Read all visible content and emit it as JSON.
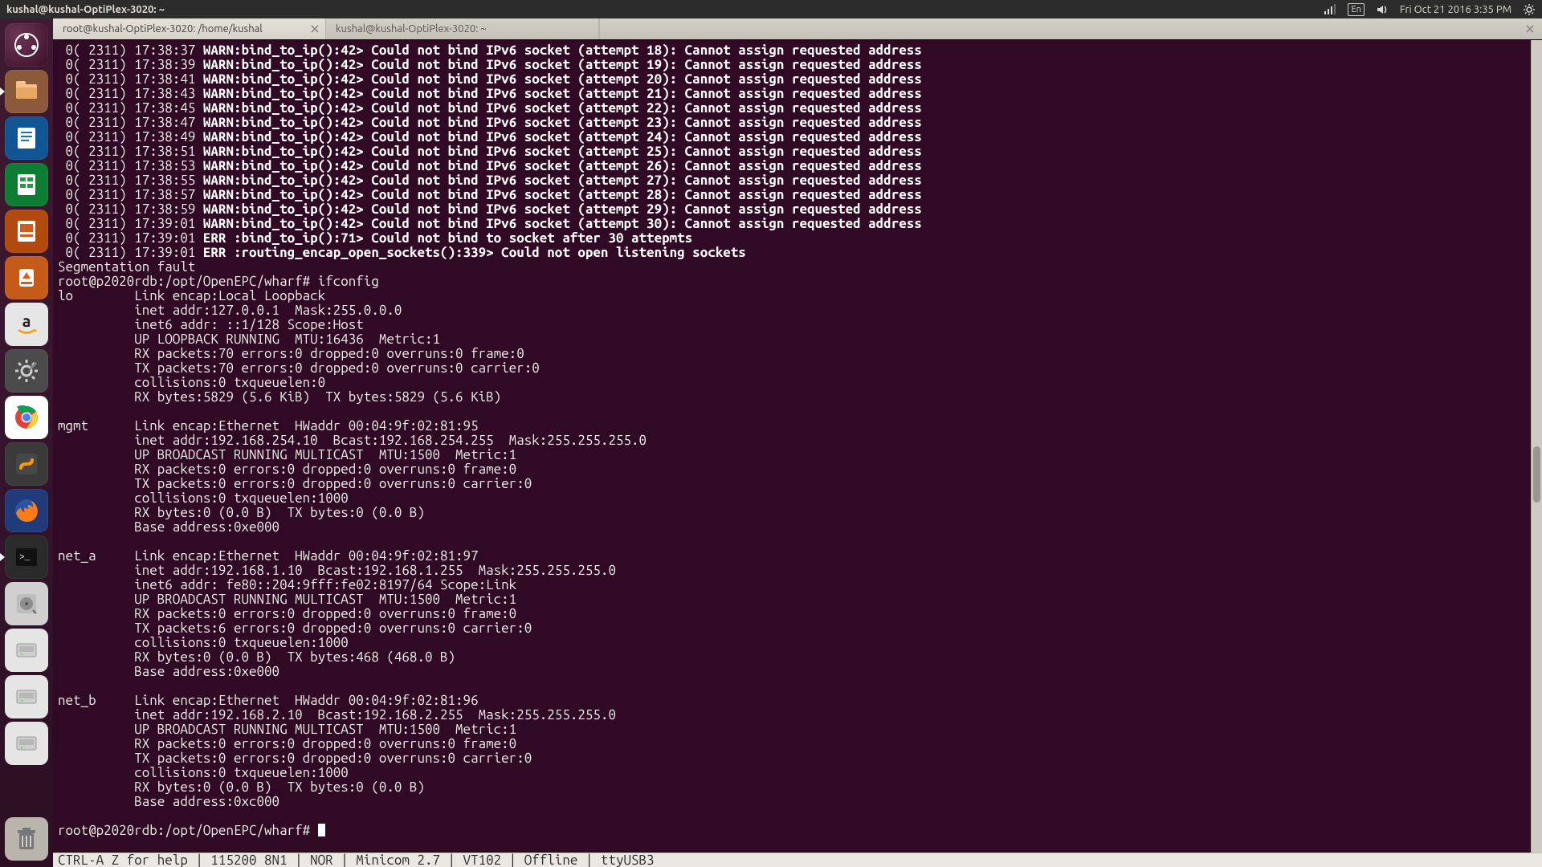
{
  "panel": {
    "window_title": "kushal@kushal-OptiPlex-3020: ~",
    "lang": "En",
    "clock": "Fri Oct 21 2016  3:35 PM"
  },
  "tabs": [
    {
      "title": "root@kushal-OptiPlex-3020: /home/kushal",
      "active": true
    },
    {
      "title": "kushal@kushal-OptiPlex-3020: ~",
      "active": false
    }
  ],
  "launcher": [
    {
      "name": "dash-icon",
      "cls": "dash"
    },
    {
      "name": "files-icon",
      "cls": "files",
      "running": true
    },
    {
      "name": "writer-icon",
      "cls": "writer"
    },
    {
      "name": "calc-icon",
      "cls": "calc"
    },
    {
      "name": "impress-icon",
      "cls": "impress"
    },
    {
      "name": "software-center-icon",
      "cls": "soft"
    },
    {
      "name": "amazon-icon",
      "cls": "amazon"
    },
    {
      "name": "settings-icon",
      "cls": "settings"
    },
    {
      "name": "chrome-icon",
      "cls": "chrome"
    },
    {
      "name": "sublime-icon",
      "cls": "subl"
    },
    {
      "name": "firefox-icon",
      "cls": "firefox"
    },
    {
      "name": "terminal-icon",
      "cls": "term",
      "active": true
    },
    {
      "name": "disks-icon",
      "cls": "disks"
    },
    {
      "name": "drive1-icon",
      "cls": "drive"
    },
    {
      "name": "drive2-icon",
      "cls": "drive"
    },
    {
      "name": "drive3-icon",
      "cls": "drive"
    }
  ],
  "warn_lines": [
    {
      "pre": " 0( 2311) 17:38:37 ",
      "bold": "WARN:bind_to_ip():42> Could not bind IPv6 socket (attempt 18): Cannot assign requested address"
    },
    {
      "pre": " 0( 2311) 17:38:39 ",
      "bold": "WARN:bind_to_ip():42> Could not bind IPv6 socket (attempt 19): Cannot assign requested address"
    },
    {
      "pre": " 0( 2311) 17:38:41 ",
      "bold": "WARN:bind_to_ip():42> Could not bind IPv6 socket (attempt 20): Cannot assign requested address"
    },
    {
      "pre": " 0( 2311) 17:38:43 ",
      "bold": "WARN:bind_to_ip():42> Could not bind IPv6 socket (attempt 21): Cannot assign requested address"
    },
    {
      "pre": " 0( 2311) 17:38:45 ",
      "bold": "WARN:bind_to_ip():42> Could not bind IPv6 socket (attempt 22): Cannot assign requested address"
    },
    {
      "pre": " 0( 2311) 17:38:47 ",
      "bold": "WARN:bind_to_ip():42> Could not bind IPv6 socket (attempt 23): Cannot assign requested address"
    },
    {
      "pre": " 0( 2311) 17:38:49 ",
      "bold": "WARN:bind_to_ip():42> Could not bind IPv6 socket (attempt 24): Cannot assign requested address"
    },
    {
      "pre": " 0( 2311) 17:38:51 ",
      "bold": "WARN:bind_to_ip():42> Could not bind IPv6 socket (attempt 25): Cannot assign requested address"
    },
    {
      "pre": " 0( 2311) 17:38:53 ",
      "bold": "WARN:bind_to_ip():42> Could not bind IPv6 socket (attempt 26): Cannot assign requested address"
    },
    {
      "pre": " 0( 2311) 17:38:55 ",
      "bold": "WARN:bind_to_ip():42> Could not bind IPv6 socket (attempt 27): Cannot assign requested address"
    },
    {
      "pre": " 0( 2311) 17:38:57 ",
      "bold": "WARN:bind_to_ip():42> Could not bind IPv6 socket (attempt 28): Cannot assign requested address"
    },
    {
      "pre": " 0( 2311) 17:38:59 ",
      "bold": "WARN:bind_to_ip():42> Could not bind IPv6 socket (attempt 29): Cannot assign requested address"
    },
    {
      "pre": " 0( 2311) 17:39:01 ",
      "bold": "WARN:bind_to_ip():42> Could not bind IPv6 socket (attempt 30): Cannot assign requested address"
    },
    {
      "pre": " 0( 2311) 17:39:01 ",
      "bold": "ERR :bind_to_ip():71> Could not bind to socket after 30 attepmts"
    },
    {
      "pre": " 0( 2311) 17:39:01 ",
      "bold": "ERR :routing_encap_open_sockets():339> Could not open listening sockets"
    }
  ],
  "plain_lines_1": [
    "Segmentation fault",
    "root@p2020rdb:/opt/OpenEPC/wharf# ifconfig",
    "lo        Link encap:Local Loopback",
    "          inet addr:127.0.0.1  Mask:255.0.0.0",
    "          inet6 addr: ::1/128 Scope:Host",
    "          UP LOOPBACK RUNNING  MTU:16436  Metric:1",
    "          RX packets:70 errors:0 dropped:0 overruns:0 frame:0",
    "          TX packets:70 errors:0 dropped:0 overruns:0 carrier:0",
    "          collisions:0 txqueuelen:0",
    "          RX bytes:5829 (5.6 KiB)  TX bytes:5829 (5.6 KiB)",
    "",
    "mgmt      Link encap:Ethernet  HWaddr 00:04:9f:02:81:95",
    "          inet addr:192.168.254.10  Bcast:192.168.254.255  Mask:255.255.255.0",
    "          UP BROADCAST RUNNING MULTICAST  MTU:1500  Metric:1",
    "          RX packets:0 errors:0 dropped:0 overruns:0 frame:0",
    "          TX packets:0 errors:0 dropped:0 overruns:0 carrier:0",
    "          collisions:0 txqueuelen:1000",
    "          RX bytes:0 (0.0 B)  TX bytes:0 (0.0 B)",
    "          Base address:0xe000",
    "",
    "net_a     Link encap:Ethernet  HWaddr 00:04:9f:02:81:97",
    "          inet addr:192.168.1.10  Bcast:192.168.1.255  Mask:255.255.255.0",
    "          inet6 addr: fe80::204:9fff:fe02:8197/64 Scope:Link",
    "          UP BROADCAST RUNNING MULTICAST  MTU:1500  Metric:1",
    "          RX packets:0 errors:0 dropped:0 overruns:0 frame:0",
    "          TX packets:6 errors:0 dropped:0 overruns:0 carrier:0",
    "          collisions:0 txqueuelen:1000",
    "          RX bytes:0 (0.0 B)  TX bytes:468 (468.0 B)",
    "          Base address:0xe000",
    "",
    "net_b     Link encap:Ethernet  HWaddr 00:04:9f:02:81:96",
    "          inet addr:192.168.2.10  Bcast:192.168.2.255  Mask:255.255.255.0",
    "          UP BROADCAST RUNNING MULTICAST  MTU:1500  Metric:1",
    "          RX packets:0 errors:0 dropped:0 overruns:0 frame:0",
    "          TX packets:0 errors:0 dropped:0 overruns:0 carrier:0",
    "          collisions:0 txqueuelen:1000",
    "          RX bytes:0 (0.0 B)  TX bytes:0 (0.0 B)",
    "          Base address:0xc000",
    ""
  ],
  "prompt": "root@p2020rdb:/opt/OpenEPC/wharf# ",
  "statusbar": "CTRL-A Z for help | 115200 8N1 | NOR | Minicom 2.7 | VT102 | Offline | ttyUSB3"
}
